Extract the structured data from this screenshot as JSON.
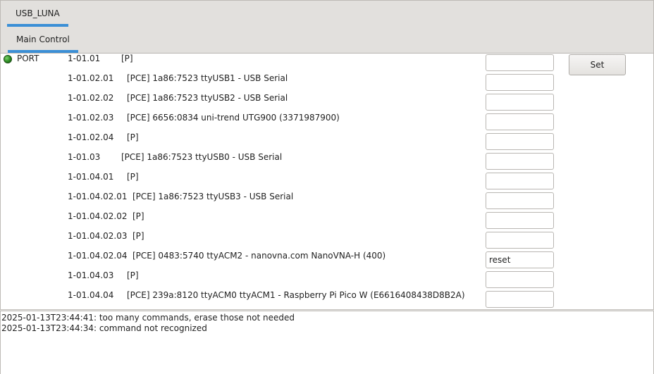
{
  "window_tabs": [
    "USB_LUNA"
  ],
  "sub_tabs": [
    "Main Control"
  ],
  "port": {
    "label": "PORT",
    "status_color": "#2c8a22"
  },
  "set_button": "Set",
  "rows": [
    {
      "id": "1-01.01",
      "desc": "[P]",
      "value": ""
    },
    {
      "id": "1-01.02.01",
      "desc": "[PCE] 1a86:7523 ttyUSB1 - USB Serial",
      "value": ""
    },
    {
      "id": "1-01.02.02",
      "desc": "[PCE] 1a86:7523 ttyUSB2 - USB Serial",
      "value": ""
    },
    {
      "id": "1-01.02.03",
      "desc": "[PCE] 6656:0834 uni-trend UTG900 (3371987900)",
      "value": ""
    },
    {
      "id": "1-01.02.04",
      "desc": "[P]",
      "value": ""
    },
    {
      "id": "1-01.03",
      "desc": "[PCE] 1a86:7523 ttyUSB0 - USB Serial",
      "value": ""
    },
    {
      "id": "1-01.04.01",
      "desc": "[P]",
      "value": ""
    },
    {
      "id": "1-01.04.02.01",
      "desc": "[PCE] 1a86:7523 ttyUSB3 - USB Serial",
      "value": ""
    },
    {
      "id": "1-01.04.02.02",
      "desc": "[P]",
      "value": ""
    },
    {
      "id": "1-01.04.02.03",
      "desc": "[P]",
      "value": ""
    },
    {
      "id": "1-01.04.02.04",
      "desc": "[PCE] 0483:5740 ttyACM2 - nanovna.com NanoVNA-H (400)",
      "value": "reset"
    },
    {
      "id": "1-01.04.03",
      "desc": "[P]",
      "value": ""
    },
    {
      "id": "1-01.04.04",
      "desc": "[PCE] 239a:8120 ttyACM0 ttyACM1 - Raspberry Pi Pico W (E6616408438D8B2A)",
      "value": ""
    }
  ],
  "log": [
    "2025-01-13T23:44:41: too many commands, erase those not needed",
    "2025-01-13T23:44:34: command not recognized"
  ]
}
